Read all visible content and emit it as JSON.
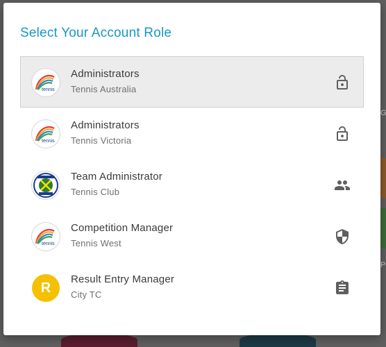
{
  "background": {
    "edge_letter_top": "G",
    "edge_letter_bottom": "P"
  },
  "dialog": {
    "title": "Select Your Account Role",
    "roles": [
      {
        "name": "Administrators",
        "org": "Tennis Australia",
        "logo": "tennis-logo",
        "icon": "lock-open-icon",
        "selected": true
      },
      {
        "name": "Administrators",
        "org": "Tennis Victoria",
        "logo": "tennis-logo",
        "icon": "lock-open-icon",
        "selected": false
      },
      {
        "name": "Team Administrator",
        "org": "Tennis Club",
        "logo": "club-crest",
        "icon": "people-icon",
        "selected": false
      },
      {
        "name": "Competition Manager",
        "org": "Tennis West",
        "logo": "tennis-logo",
        "icon": "shield-icon",
        "selected": false
      },
      {
        "name": "Result Entry Manager",
        "org": "City TC",
        "logo": "letter-avatar",
        "avatar_letter": "R",
        "icon": "clipboard-icon",
        "selected": false
      }
    ]
  },
  "colors": {
    "title": "#1a95c9",
    "selected_row": "#ececec",
    "letter_avatar": "#f5c000"
  }
}
